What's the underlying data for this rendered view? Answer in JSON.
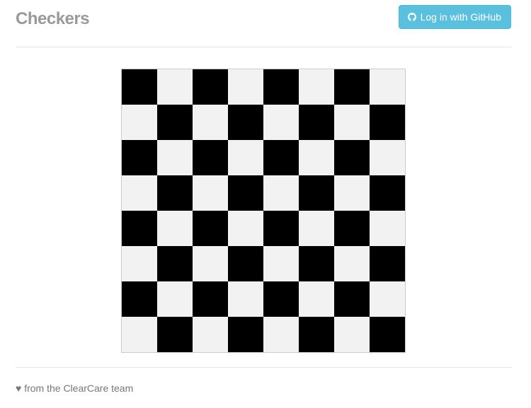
{
  "header": {
    "title": "Checkers",
    "login_button": {
      "icon": "github-icon",
      "label": "Log in with GitHub"
    }
  },
  "board": {
    "size": 8,
    "top_left": "dark",
    "colors": {
      "dark": "#000000",
      "light": "#f2f2f2",
      "border": "#cccccc"
    },
    "pieces": []
  },
  "footer": {
    "heart": "♥",
    "text": "from the ClearCare team"
  },
  "colors": {
    "accent": "#5bc0de",
    "title": "#999999",
    "divider": "#e5e5e5"
  }
}
